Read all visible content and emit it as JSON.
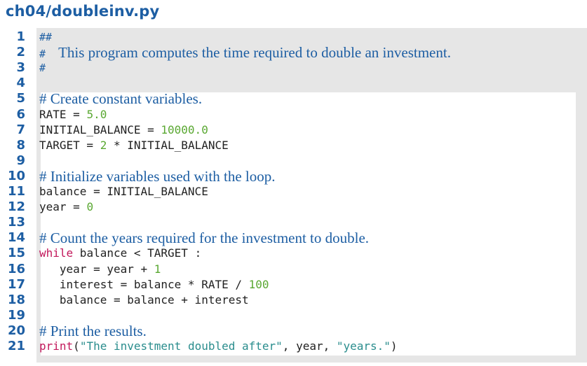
{
  "filename": "ch04/doubleinv.py",
  "lines": [
    {
      "n": "1",
      "segs": [
        {
          "t": "##",
          "c": "hash"
        }
      ]
    },
    {
      "n": "2",
      "segs": [
        {
          "t": "#  ",
          "c": "hash"
        },
        {
          "t": "This program computes the time required to double an investment.",
          "c": "comment"
        }
      ]
    },
    {
      "n": "3",
      "segs": [
        {
          "t": "#",
          "c": "hash"
        }
      ]
    },
    {
      "n": "4",
      "segs": []
    },
    {
      "n": "5",
      "segs": [
        {
          "t": "# Create constant variables.",
          "c": "comment"
        }
      ]
    },
    {
      "n": "6",
      "segs": [
        {
          "t": "RATE = ",
          "c": ""
        },
        {
          "t": "5.0",
          "c": "num"
        }
      ]
    },
    {
      "n": "7",
      "segs": [
        {
          "t": "INITIAL_BALANCE = ",
          "c": ""
        },
        {
          "t": "10000.0",
          "c": "num"
        }
      ]
    },
    {
      "n": "8",
      "segs": [
        {
          "t": "TARGET = ",
          "c": ""
        },
        {
          "t": "2",
          "c": "num"
        },
        {
          "t": " * INITIAL_BALANCE",
          "c": ""
        }
      ]
    },
    {
      "n": "9",
      "segs": []
    },
    {
      "n": "10",
      "segs": [
        {
          "t": "# Initialize variables used with the loop.",
          "c": "comment"
        }
      ]
    },
    {
      "n": "11",
      "segs": [
        {
          "t": "balance = INITIAL_BALANCE",
          "c": ""
        }
      ]
    },
    {
      "n": "12",
      "segs": [
        {
          "t": "year = ",
          "c": ""
        },
        {
          "t": "0",
          "c": "num"
        }
      ]
    },
    {
      "n": "13",
      "segs": []
    },
    {
      "n": "14",
      "segs": [
        {
          "t": "# Count the years required for the investment to double.",
          "c": "comment"
        }
      ]
    },
    {
      "n": "15",
      "segs": [
        {
          "t": "while",
          "c": "kw"
        },
        {
          "t": " balance < TARGET :",
          "c": ""
        }
      ]
    },
    {
      "n": "16",
      "segs": [
        {
          "t": "   year = year + ",
          "c": ""
        },
        {
          "t": "1",
          "c": "num"
        }
      ]
    },
    {
      "n": "17",
      "segs": [
        {
          "t": "   interest = balance * RATE / ",
          "c": ""
        },
        {
          "t": "100",
          "c": "num"
        }
      ]
    },
    {
      "n": "18",
      "segs": [
        {
          "t": "   balance = balance + interest",
          "c": ""
        }
      ]
    },
    {
      "n": "19",
      "segs": []
    },
    {
      "n": "20",
      "segs": [
        {
          "t": "# Print the results.",
          "c": "comment"
        }
      ]
    },
    {
      "n": "21",
      "segs": [
        {
          "t": "print",
          "c": "kw"
        },
        {
          "t": "(",
          "c": ""
        },
        {
          "t": "\"The investment doubled after\"",
          "c": "str"
        },
        {
          "t": ", year, ",
          "c": ""
        },
        {
          "t": "\"years.\"",
          "c": "str"
        },
        {
          "t": ")",
          "c": ""
        }
      ]
    }
  ]
}
